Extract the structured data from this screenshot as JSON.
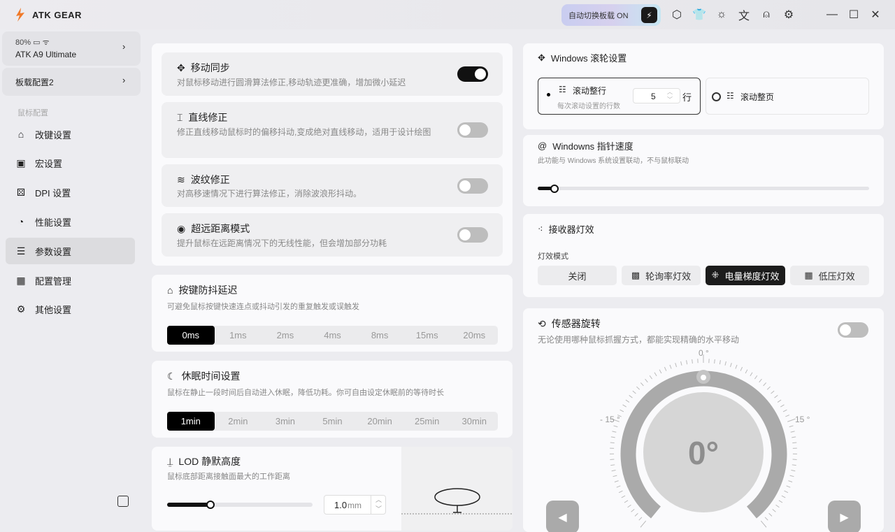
{
  "app": {
    "brand": "ATK GEAR",
    "auto_switch": "自动切换板载 ON",
    "accent": "#f07a2a"
  },
  "toolbar_icons": [
    "cube-icon",
    "shirt-icon",
    "brightness-icon",
    "translate-icon",
    "user-icon",
    "settings-icon"
  ],
  "sidebar": {
    "device": {
      "battery": "80%",
      "name": "ATK A9 Ultimate"
    },
    "profile": "板载配置2",
    "section": "鼠标配置",
    "items": [
      {
        "label": "改键设置"
      },
      {
        "label": "宏设置"
      },
      {
        "label": "DPI 设置"
      },
      {
        "label": "性能设置"
      },
      {
        "label": "参数设置",
        "active": true
      },
      {
        "label": "配置管理"
      },
      {
        "label": "其他设置"
      }
    ]
  },
  "motion": [
    {
      "title": "移动同步",
      "desc": "对鼠标移动进行圆滑算法修正,移动轨迹更准确，增加微小延迟",
      "on": true
    },
    {
      "title": "直线修正",
      "desc": "修正直线移动鼠标时的偏移抖动,变成绝对直线移动，适用于设计绘图",
      "on": false
    },
    {
      "title": "波纹修正",
      "desc": "对高移速情况下进行算法修正，消除波浪形抖动。",
      "on": false
    },
    {
      "title": "超远距离模式",
      "desc": "提升鼠标在远距离情况下的无线性能，但会增加部分功耗",
      "on": false
    }
  ],
  "debounce": {
    "title": "按键防抖延迟",
    "desc": "可避免鼠标按键快速连点或抖动引发的重复触发或误触发",
    "options": [
      "0ms",
      "1ms",
      "2ms",
      "4ms",
      "8ms",
      "15ms",
      "20ms"
    ],
    "selected": 0
  },
  "sleep": {
    "title": "休眠时间设置",
    "desc": "鼠标在静止一段时间后自动进入休眠，降低功耗。你可自由设定休眠前的等待时长",
    "options": [
      "1min",
      "2min",
      "3min",
      "5min",
      "20min",
      "25min",
      "30min"
    ],
    "selected": 0
  },
  "lod": {
    "title": "LOD 静默高度",
    "desc": "鼠标底部距离接触面最大的工作距离",
    "value": "1.0",
    "unit": "mm",
    "percent": 30
  },
  "wheel": {
    "title": "Windows 滚轮设置",
    "line_label": "滚动整行",
    "line_desc": "每次滚动设置的行数",
    "lines": "5",
    "line_unit": "行",
    "page_label": "滚动整页"
  },
  "pointer": {
    "title": "Windowns 指针速度",
    "desc": "此功能与 Windows 系统设置联动，不与鼠标联动",
    "percent": 5
  },
  "receiver": {
    "title": "接收器灯效",
    "mode_label": "灯效模式",
    "options": [
      "关闭",
      "轮询率灯效",
      "电量梯度灯效",
      "低压灯效"
    ],
    "selected": 2
  },
  "sensor": {
    "title": "传感器旋转",
    "desc": "无论使用哪种鼠标抓握方式，都能实现精确的水平移动",
    "on": false,
    "value": "0°",
    "tick_top": "0 °",
    "tick_left": "- 15 °",
    "tick_right": "15 °"
  }
}
